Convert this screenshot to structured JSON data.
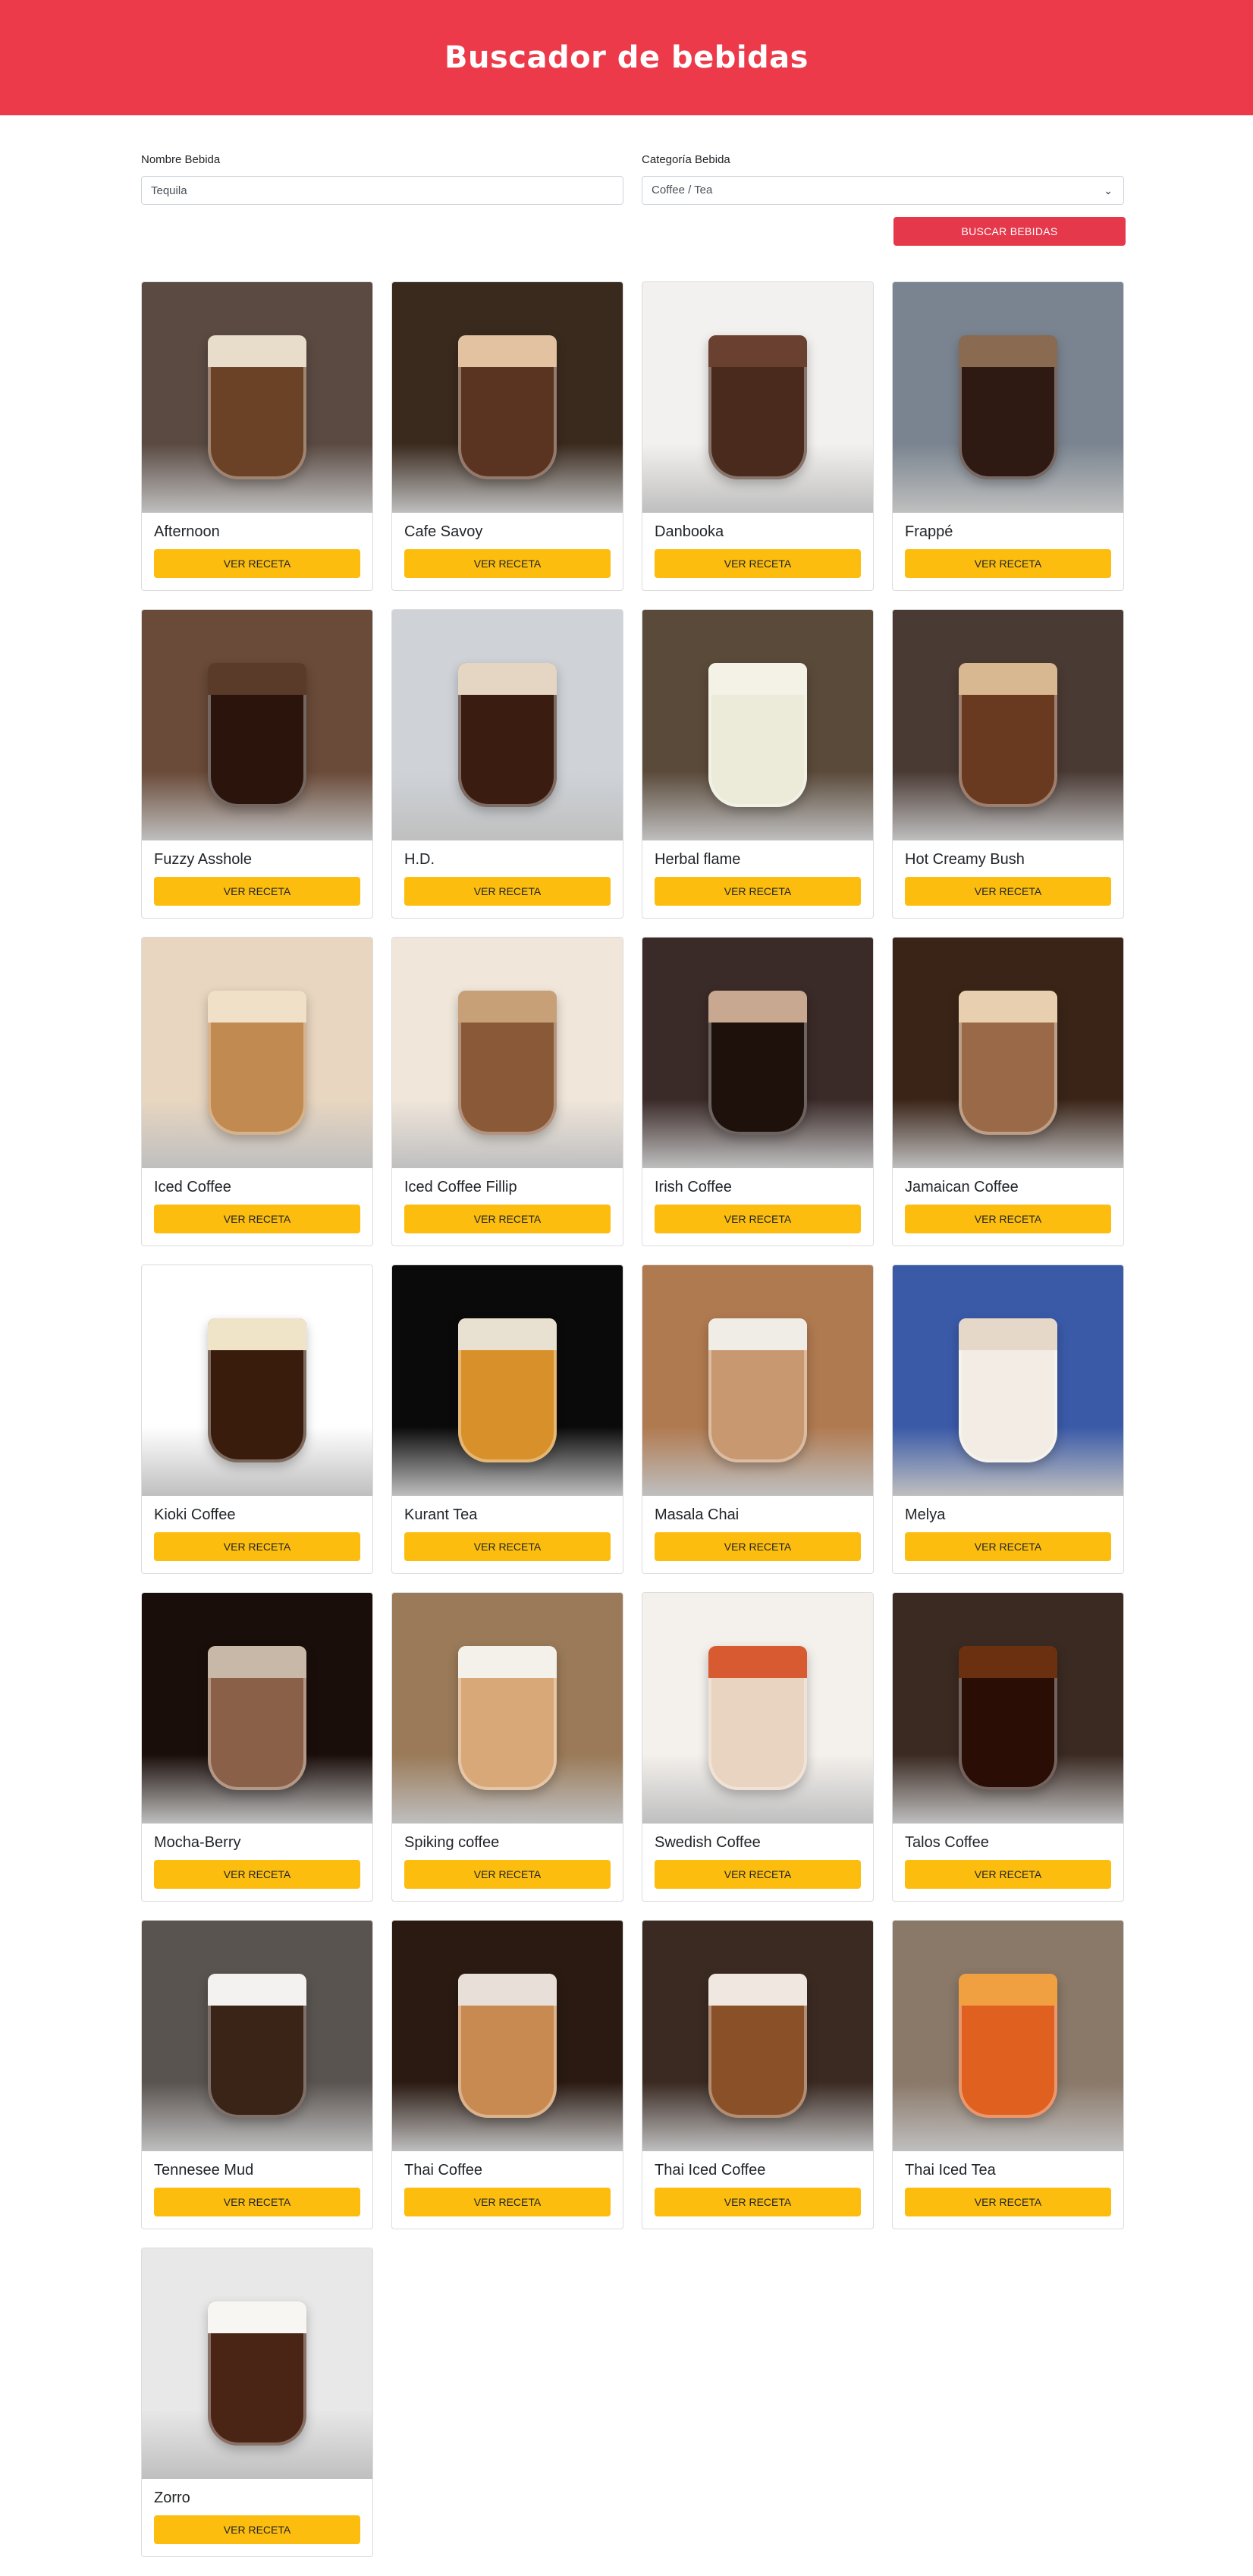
{
  "header": {
    "title": "Buscador de bebidas"
  },
  "form": {
    "name_label": "Nombre Bebida",
    "name_value": "Tequila",
    "category_label": "Categoría Bebida",
    "category_value": "Coffee / Tea",
    "search_button": "BUSCAR BEBIDAS"
  },
  "card_button_label": "VER RECETA",
  "drinks": [
    {
      "name": "Afternoon",
      "bg": "#5a4a42",
      "drink": "#6b4226",
      "foam": "#e8dccb"
    },
    {
      "name": "Cafe Savoy",
      "bg": "#3a2a1e",
      "drink": "#5a3420",
      "foam": "#e2c2a0"
    },
    {
      "name": "Danbooka",
      "bg": "#f3f1ef",
      "drink": "#4a2a1c",
      "foam": "#6a4030"
    },
    {
      "name": "Frappé",
      "bg": "#7a8490",
      "drink": "#2e1a12",
      "foam": "#8a6a50"
    },
    {
      "name": "Fuzzy Asshole",
      "bg": "#6a4a38",
      "drink": "#2a140c",
      "foam": "#5a3a28"
    },
    {
      "name": "H.D.",
      "bg": "#cfd3d8",
      "drink": "#3a1c10",
      "foam": "#e4d6c2"
    },
    {
      "name": "Herbal flame",
      "bg": "#5a4a3a",
      "drink": "#ecead8",
      "foam": "#f4f2e6"
    },
    {
      "name": "Hot Creamy Bush",
      "bg": "#4a3a34",
      "drink": "#6a3a20",
      "foam": "#d8b890"
    },
    {
      "name": "Iced Coffee",
      "bg": "#e8d6c0",
      "drink": "#c08a50",
      "foam": "#f0e0c8"
    },
    {
      "name": "Iced Coffee Fillip",
      "bg": "#f0e6da",
      "drink": "#8a5a38",
      "foam": "#c8a078"
    },
    {
      "name": "Irish Coffee",
      "bg": "#3a2a28",
      "drink": "#1e100a",
      "foam": "#c8a890"
    },
    {
      "name": "Jamaican Coffee",
      "bg": "#3a2418",
      "drink": "#9a6a48",
      "foam": "#e8cfb0"
    },
    {
      "name": "Kioki Coffee",
      "bg": "#ffffff",
      "drink": "#3a1c0c",
      "foam": "#f0e4c8"
    },
    {
      "name": "Kurant Tea",
      "bg": "#0a0a0a",
      "drink": "#d8902a",
      "foam": "#e8e0d0"
    },
    {
      "name": "Masala Chai",
      "bg": "#b07a50",
      "drink": "#c89870",
      "foam": "#f0ece6"
    },
    {
      "name": "Melya",
      "bg": "#3a5aa8",
      "drink": "#f2ece4",
      "foam": "#e6d8c8"
    },
    {
      "name": "Mocha-Berry",
      "bg": "#1a0e0a",
      "drink": "#8a6048",
      "foam": "#c8b8a8"
    },
    {
      "name": "Spiking coffee",
      "bg": "#9a7a58",
      "drink": "#d8a878",
      "foam": "#f4f0ea"
    },
    {
      "name": "Swedish Coffee",
      "bg": "#f4f0ec",
      "drink": "#e8d4c0",
      "foam": "#d85a30"
    },
    {
      "name": "Talos Coffee",
      "bg": "#3a2a22",
      "drink": "#2a0e06",
      "foam": "#6a3010"
    },
    {
      "name": "Tennesee Mud",
      "bg": "#5a5450",
      "drink": "#3a2418",
      "foam": "#f4f2f0"
    },
    {
      "name": "Thai Coffee",
      "bg": "#2a1a12",
      "drink": "#c88a50",
      "foam": "#e8e0d8"
    },
    {
      "name": "Thai Iced Coffee",
      "bg": "#3a2a22",
      "drink": "#8a5028",
      "foam": "#f0e8e0"
    },
    {
      "name": "Thai Iced Tea",
      "bg": "#8a7868",
      "drink": "#e06020",
      "foam": "#f0a040"
    },
    {
      "name": "Zorro",
      "bg": "#e8e8e8",
      "drink": "#4a2414",
      "foam": "#f8f6f2"
    }
  ]
}
